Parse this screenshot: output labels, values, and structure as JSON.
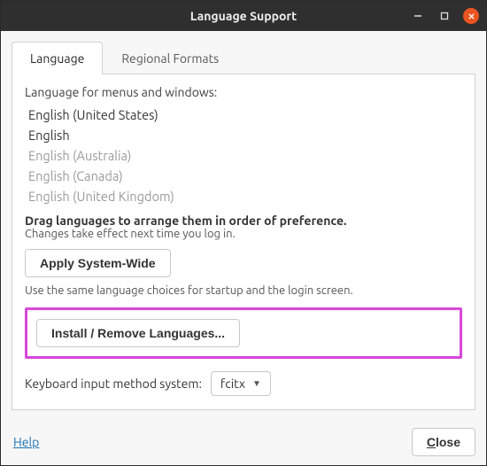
{
  "window": {
    "title": "Language Support"
  },
  "tabs": {
    "language": "Language",
    "regional": "Regional Formats"
  },
  "panel": {
    "menus_label": "Language for menus and windows:",
    "languages": [
      {
        "name": "English (United States)",
        "active": true
      },
      {
        "name": "English",
        "active": true
      },
      {
        "name": "English (Australia)",
        "active": false
      },
      {
        "name": "English (Canada)",
        "active": false
      },
      {
        "name": "English (United Kingdom)",
        "active": false
      }
    ],
    "drag_hint": "Drag languages to arrange them in order of preference.",
    "login_hint": "Changes take effect next time you log in.",
    "apply_button": "Apply System-Wide",
    "apply_note": "Use the same language choices for startup and the login screen.",
    "install_button": "Install / Remove Languages...",
    "keyboard_label": "Keyboard input method system:",
    "keyboard_value": "fcitx"
  },
  "footer": {
    "help": "Help",
    "close_prefix": "C",
    "close_rest": "lose"
  }
}
